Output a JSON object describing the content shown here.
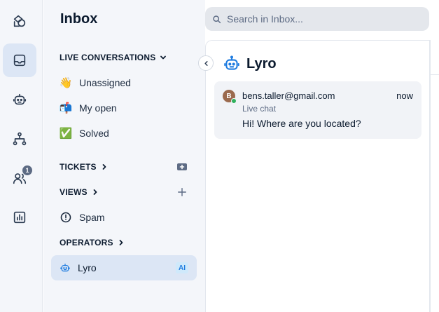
{
  "rail": {
    "items": [
      {
        "name": "shapes-icon"
      },
      {
        "name": "inbox-tray-icon",
        "active": true
      },
      {
        "name": "bot-icon"
      },
      {
        "name": "flow-icon"
      },
      {
        "name": "contacts-icon",
        "badge": "1"
      },
      {
        "name": "analytics-icon"
      }
    ]
  },
  "panel": {
    "title": "Inbox",
    "live_conversations": {
      "label": "LIVE CONVERSATIONS",
      "items": [
        {
          "emoji": "👋",
          "label": "Unassigned"
        },
        {
          "emoji": "📬",
          "label": "My open"
        },
        {
          "emoji": "✅",
          "label": "Solved"
        }
      ]
    },
    "tickets": {
      "label": "TICKETS"
    },
    "views": {
      "label": "VIEWS"
    },
    "spam": {
      "label": "Spam"
    },
    "operators": {
      "label": "OPERATORS"
    },
    "lyro": {
      "label": "Lyro",
      "badge": "AI"
    }
  },
  "search": {
    "placeholder": "Search in Inbox..."
  },
  "conversation_list": {
    "title": "Lyro",
    "items": [
      {
        "avatar_initial": "B",
        "email": "bens.taller@gmail.com",
        "time": "now",
        "channel": "Live chat",
        "message": "Hi! Where are you located?"
      }
    ]
  },
  "colors": {
    "accent": "#1f7ce0",
    "active_bg": "#dce6f5",
    "online": "#2fb15d",
    "avatar": "#9b6a4e"
  }
}
